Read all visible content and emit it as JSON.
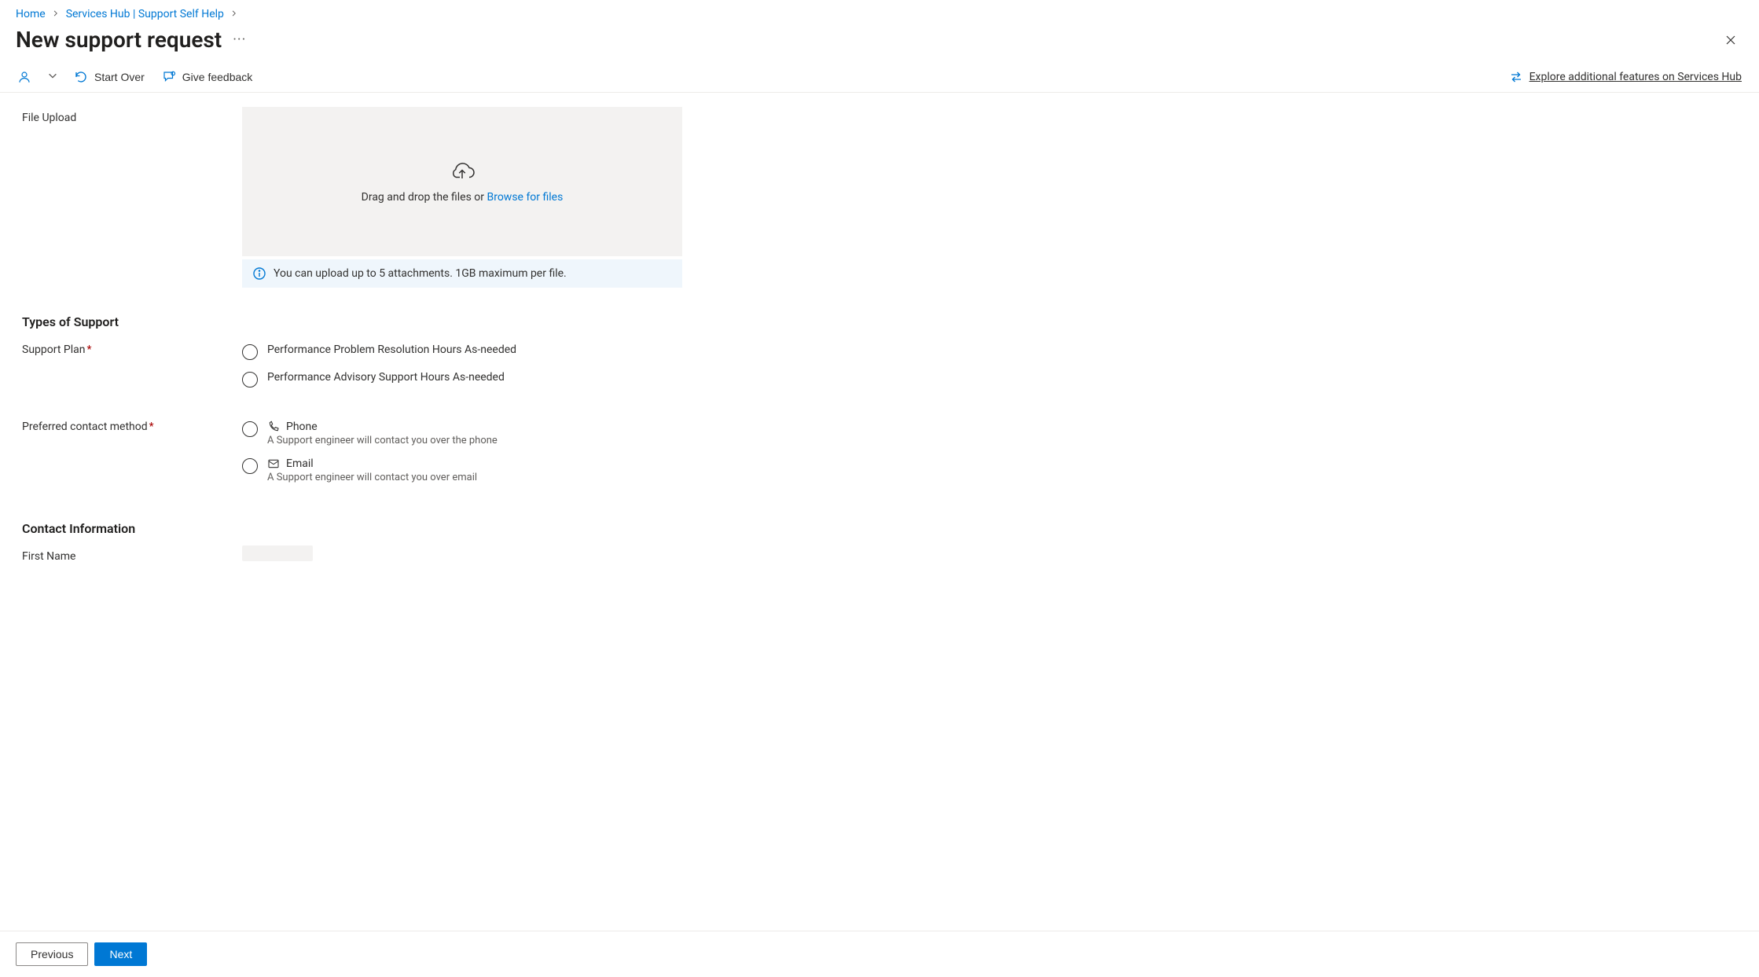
{
  "breadcrumb": {
    "items": [
      {
        "label": "Home"
      },
      {
        "label": "Services Hub | Support Self Help"
      }
    ]
  },
  "page": {
    "title": "New support request"
  },
  "toolbar": {
    "start_over": "Start Over",
    "give_feedback": "Give feedback",
    "explore_link": "Explore additional features on Services Hub"
  },
  "file_upload": {
    "label": "File Upload",
    "drop_prefix": "Drag and drop the files or ",
    "browse_link": "Browse for files",
    "info": "You can upload up to 5 attachments. 1GB maximum per file."
  },
  "types_of_support": {
    "heading": "Types of Support",
    "support_plan_label": "Support Plan",
    "options": [
      "Performance Problem Resolution Hours As-needed",
      "Performance Advisory Support Hours As-needed"
    ],
    "preferred_contact_label": "Preferred contact method",
    "contact_options": [
      {
        "label": "Phone",
        "desc": "A Support engineer will contact you over the phone"
      },
      {
        "label": "Email",
        "desc": "A Support engineer will contact you over email"
      }
    ]
  },
  "contact_info": {
    "heading": "Contact Information",
    "first_name_label": "First Name"
  },
  "buttons": {
    "previous": "Previous",
    "next": "Next"
  }
}
